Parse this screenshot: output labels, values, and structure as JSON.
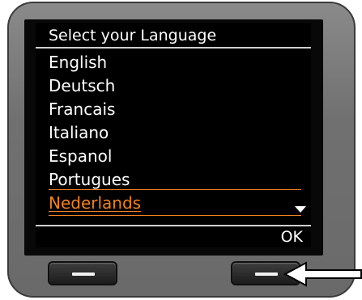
{
  "screen": {
    "title": "Select your Language",
    "languages": [
      {
        "label": "English",
        "selected": false
      },
      {
        "label": "Deutsch",
        "selected": false
      },
      {
        "label": "Francais",
        "selected": false
      },
      {
        "label": "Italiano",
        "selected": false
      },
      {
        "label": "Espanol",
        "selected": false
      },
      {
        "label": "Portugues",
        "selected": false
      },
      {
        "label": "Nederlands",
        "selected": true
      }
    ],
    "softkey_right_label": "OK",
    "scroll_icon": "scroll-down-triangle"
  },
  "colors": {
    "highlight": "#f08020",
    "screen_bg": "#000000",
    "device_body": "#707070"
  },
  "icons": {
    "left_key": "softkey-left",
    "right_key": "softkey-right",
    "annotation": "pointer-arrow"
  }
}
